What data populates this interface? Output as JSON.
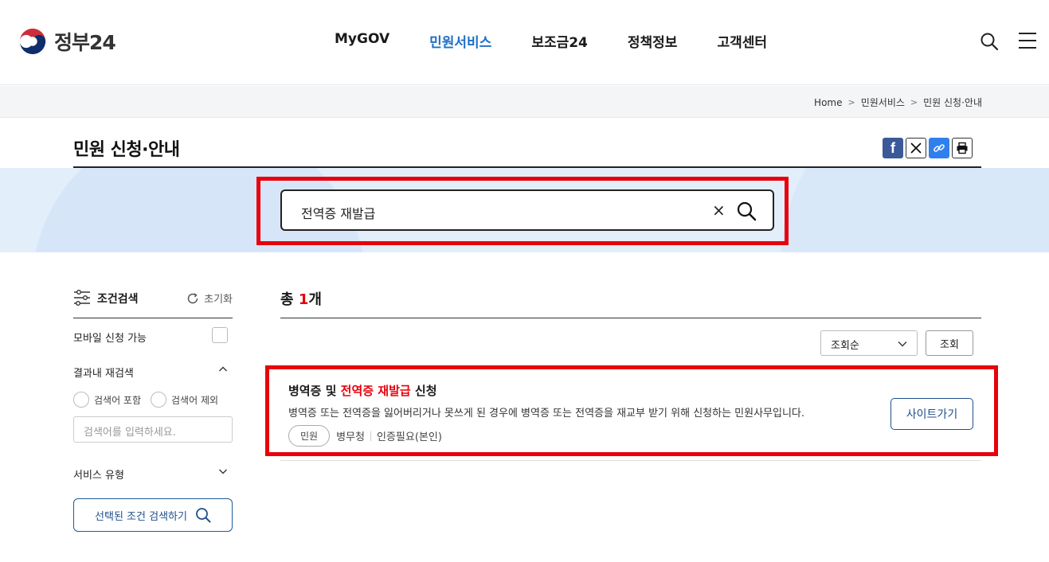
{
  "header": {
    "logo_text": "정부24",
    "nav": [
      "MyGOV",
      "민원서비스",
      "보조금24",
      "정책정보",
      "고객센터"
    ],
    "active_nav": "민원서비스"
  },
  "breadcrumb": [
    "Home",
    "민원서비스",
    "민원 신청·안내"
  ],
  "page_title": "민원 신청·안내",
  "share_icons": [
    "facebook-icon",
    "x-icon",
    "link-icon",
    "print-icon"
  ],
  "search": {
    "value": "전역증 재발급",
    "clear_glyph": "×"
  },
  "sidebar": {
    "title": "조건검색",
    "reset_label": "초기화",
    "mobile_label": "모바일 신청 가능",
    "refine_label": "결과내 재검색",
    "radio_include": "검색어 포함",
    "radio_exclude": "검색어 제외",
    "input_placeholder": "검색어를 입력하세요.",
    "service_type_label": "서비스 유형",
    "submit_label": "선택된 조건 검색하기"
  },
  "results": {
    "total_prefix": "총 ",
    "total_count": "1",
    "total_suffix": "개",
    "sort_value": "조회순",
    "sort_button": "조회",
    "items": [
      {
        "title_before": "병역증 및 ",
        "title_highlight": "전역증 재발급",
        "title_after": " 신청",
        "description": "병역증 또는 전역증을 잃어버리거나 못쓰게 된 경우에 병역증 또는 전역증을 재교부 받기 위해 신청하는 민원사무입니다.",
        "tag": "민원",
        "agency": "병무청",
        "auth": "인증필요(본인)",
        "button": "사이트가기"
      }
    ]
  },
  "colors": {
    "accent": "#1e6fc6",
    "highlight": "#e8000b",
    "search_band": "#e3eefb"
  }
}
